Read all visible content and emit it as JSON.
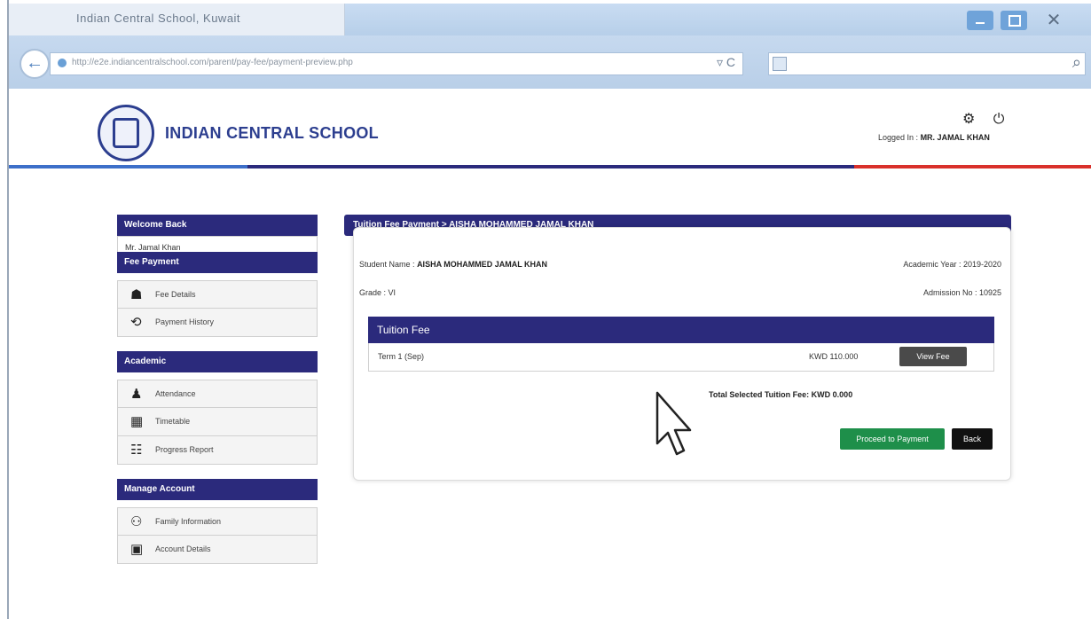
{
  "browser": {
    "tab_title": "Indian Central School, Kuwait",
    "url": "http://e2e.indiancentralschool.com/parent/pay-fee/payment-preview.php",
    "url_tools": "▿ C",
    "search_icon": "⌕",
    "back_icon": "←",
    "close_icon": "✕"
  },
  "header": {
    "school_name": "INDIAN CENTRAL SCHOOL",
    "logged_in_label": "Logged In :",
    "logged_in_user": "MR. JAMAL KHAN",
    "settings_icon": "⚙",
    "power_icon": "⏻"
  },
  "sidebar": {
    "welcome_title": "Welcome Back",
    "welcome_user": "Mr. Jamal Khan",
    "sections": [
      {
        "title": "Fee Payment",
        "items": [
          {
            "label": "Fee Details",
            "icon": "☗"
          },
          {
            "label": "Payment History",
            "icon": "⟲"
          }
        ]
      },
      {
        "title": "Academic",
        "items": [
          {
            "label": "Attendance",
            "icon": "♟"
          },
          {
            "label": "Timetable",
            "icon": "▦"
          },
          {
            "label": "Progress Report",
            "icon": "☷"
          }
        ]
      },
      {
        "title": "Manage Account",
        "items": [
          {
            "label": "Family Information",
            "icon": "⚇"
          },
          {
            "label": "Account Details",
            "icon": "▣"
          }
        ]
      }
    ]
  },
  "main": {
    "heading": "Tuition Fee Payment > AISHA MOHAMMED JAMAL KHAN",
    "student_label": "Student Name :",
    "student_name": "AISHA MOHAMMED JAMAL KHAN",
    "academic_year": "Academic Year : 2019-2020",
    "grade": "Grade : VI",
    "admission_no": "Admission No : 10925",
    "fee_section_title": "Tuition Fee",
    "fee_term": "Term 1 (Sep)",
    "fee_amount": "KWD 110.000",
    "view_button": "View Fee",
    "total_text": "Total Selected Tuition Fee: KWD 0.000",
    "proceed_button": "Proceed to Payment",
    "back_button": "Back"
  },
  "colors": {
    "navy": "#2b2a7c",
    "green": "#1e8f4a",
    "red_stripe": "#d9302b",
    "blue_stripe": "#3d6fc9"
  }
}
